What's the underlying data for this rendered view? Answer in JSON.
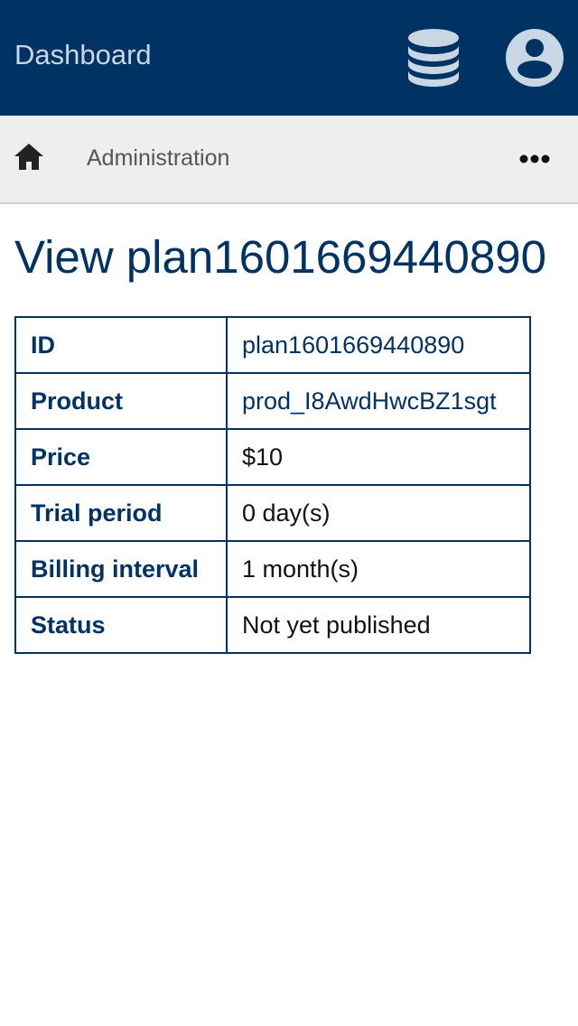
{
  "header": {
    "title": "Dashboard",
    "icons": [
      "database-icon",
      "account-circle-icon"
    ]
  },
  "nav": {
    "home_icon": "home-icon",
    "label": "Administration",
    "more_icon": "more-horizontal-icon"
  },
  "page": {
    "title": "View plan1601669440890"
  },
  "details": [
    {
      "label": "ID",
      "value": "plan1601669440890",
      "is_link": true
    },
    {
      "label": "Product",
      "value": "prod_I8AwdHwcBZ1sgt",
      "is_link": true
    },
    {
      "label": "Price",
      "value": "$10",
      "is_link": false
    },
    {
      "label": "Trial period",
      "value": "0 day(s)",
      "is_link": false
    },
    {
      "label": "Billing interval",
      "value": "1 month(s)",
      "is_link": false
    },
    {
      "label": "Status",
      "value": "Not yet published",
      "is_link": false
    }
  ],
  "colors": {
    "primary": "#003263",
    "header_text": "#c9d6e3",
    "icon": "#c9d6e3",
    "nav_background": "#eeeeee"
  }
}
